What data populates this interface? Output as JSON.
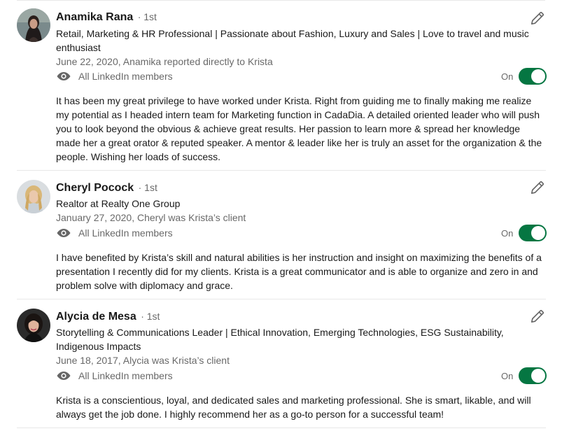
{
  "colors": {
    "toggle_on": "#057642",
    "text_secondary": "#666666"
  },
  "recommendations": [
    {
      "name": "Anamika Rana",
      "degree": "· 1st",
      "headline": "Retail, Marketing & HR Professional | Passionate about Fashion, Luxury and Sales | Love to travel and music enthusiast",
      "meta": "June 22, 2020, Anamika reported directly to Krista",
      "visibility_icon": "eye-icon",
      "visibility": "All LinkedIn members",
      "toggle_label": "On",
      "toggle_on": true,
      "edit_icon": "pencil-icon",
      "text": "It has been my great privilege to have worked under Krista. Right from guiding me to finally making me realize my potential as I headed intern team for Marketing function in CadaDia. A detailed oriented leader who will push you to look beyond the obvious & achieve great results. Her passion to learn more & spread her knowledge made her a great orator & reputed speaker. A mentor & leader like her is truly an asset for the organization & the people. Wishing her loads of success."
    },
    {
      "name": "Cheryl Pocock",
      "degree": "· 1st",
      "headline": "Realtor at Realty One Group",
      "meta": "January 27, 2020, Cheryl was Krista’s client",
      "visibility_icon": "eye-icon",
      "visibility": "All LinkedIn members",
      "toggle_label": "On",
      "toggle_on": true,
      "edit_icon": "pencil-icon",
      "text": "I have benefited by Krista’s skill and natural abilities is her instruction and insight on maximizing the benefits of a presentation I recently did for my clients. Krista is a great communicator and is able to organize and zero in and problem solve with diplomacy and grace."
    },
    {
      "name": "Alycia de Mesa",
      "degree": "· 1st",
      "headline": "Storytelling & Communications Leader | Ethical Innovation, Emerging Technologies, ESG Sustainability, Indigenous Impacts",
      "meta": "June 18, 2017, Alycia was Krista’s client",
      "visibility_icon": "eye-icon",
      "visibility": "All LinkedIn members",
      "toggle_label": "On",
      "toggle_on": true,
      "edit_icon": "pencil-icon",
      "text": "Krista is a conscientious, loyal, and dedicated sales and marketing professional. She is smart, likable, and will always get the job done. I highly recommend her as a go-to person for a successful team!"
    }
  ]
}
